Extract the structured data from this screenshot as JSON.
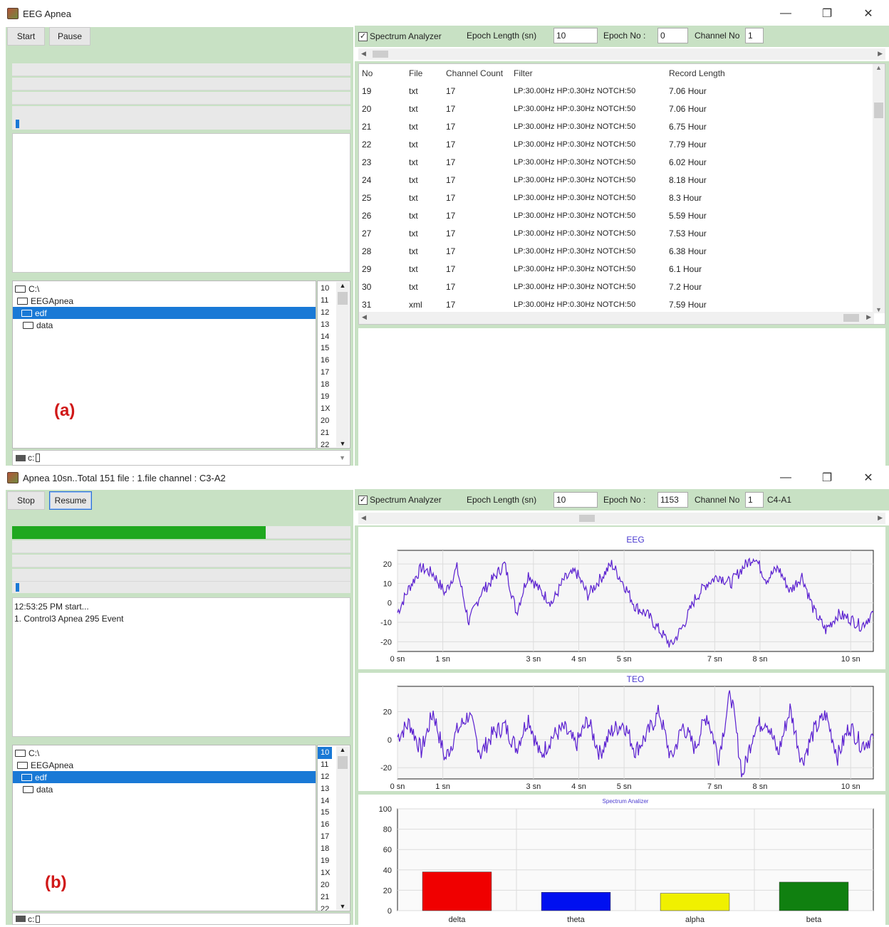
{
  "window_a": {
    "title": "EEG Apnea",
    "buttons": {
      "start": "Start",
      "pause": "Pause"
    },
    "toolbar": {
      "checkbox_checked": true,
      "checkbox_label": "Spectrum Analyzer",
      "epoch_length_label": "Epoch Length (sn)",
      "epoch_length_value": "10",
      "epoch_no_label": "Epoch No :",
      "epoch_no_value": "0",
      "channel_no_label": "Channel No",
      "channel_no_value": "1"
    },
    "table": {
      "headers": [
        "No",
        "File",
        "Channel Count",
        "Filter",
        "Record Length"
      ],
      "rows": [
        [
          "19",
          "txt",
          "17",
          "LP:30.00Hz HP:0.30Hz NOTCH:50",
          "7.06 Hour"
        ],
        [
          "20",
          "txt",
          "17",
          "LP:30.00Hz HP:0.30Hz NOTCH:50",
          "7.06 Hour"
        ],
        [
          "21",
          "txt",
          "17",
          "LP:30.00Hz HP:0.30Hz NOTCH:50",
          "6.75 Hour"
        ],
        [
          "22",
          "txt",
          "17",
          "LP:30.00Hz HP:0.30Hz NOTCH:50",
          "7.79 Hour"
        ],
        [
          "23",
          "txt",
          "17",
          "LP:30.00Hz HP:0.30Hz NOTCH:50",
          "6.02 Hour"
        ],
        [
          "24",
          "txt",
          "17",
          "LP:30.00Hz HP:0.30Hz NOTCH:50",
          "8.18 Hour"
        ],
        [
          "25",
          "txt",
          "17",
          "LP:30.00Hz HP:0.30Hz NOTCH:50",
          "8.3 Hour"
        ],
        [
          "26",
          "txt",
          "17",
          "LP:30.00Hz HP:0.30Hz NOTCH:50",
          "5.59 Hour"
        ],
        [
          "27",
          "txt",
          "17",
          "LP:30.00Hz HP:0.30Hz NOTCH:50",
          "7.53 Hour"
        ],
        [
          "28",
          "txt",
          "17",
          "LP:30.00Hz HP:0.30Hz NOTCH:50",
          "6.38 Hour"
        ],
        [
          "29",
          "txt",
          "17",
          "LP:30.00Hz HP:0.30Hz NOTCH:50",
          "6.1 Hour"
        ],
        [
          "30",
          "txt",
          "17",
          "LP:30.00Hz HP:0.30Hz NOTCH:50",
          "7.2 Hour"
        ],
        [
          "31",
          "xml",
          "17",
          "LP:30.00Hz HP:0.30Hz NOTCH:50",
          "7.59 Hour"
        ]
      ]
    },
    "tree": [
      "C:\\",
      "EEGApnea",
      "edf",
      "data"
    ],
    "files": [
      "10",
      "11",
      "12",
      "13",
      "14",
      "15",
      "16",
      "17",
      "18",
      "19",
      "1X",
      "20",
      "21",
      "22"
    ],
    "drive": "c:",
    "label": "(a)"
  },
  "window_b": {
    "title": "Apnea 10sn..Total 151  file : 1.file channel : C3-A2",
    "buttons": {
      "stop": "Stop",
      "resume": "Resume"
    },
    "progress_fraction": 0.75,
    "toolbar": {
      "checkbox_checked": true,
      "checkbox_label": "Spectrum Analyzer",
      "epoch_length_label": "Epoch Length (sn)",
      "epoch_length_value": "10",
      "epoch_no_label": "Epoch No :",
      "epoch_no_value": "1153",
      "channel_no_label": "Channel No",
      "channel_no_value": "1",
      "channel_name": "C4-A1"
    },
    "log": [
      "12:53:25 PM   start...",
      "1. Control3 Apnea 295 Event"
    ],
    "tree": [
      "C:\\",
      "EEGApnea",
      "edf",
      "data"
    ],
    "files": [
      "10",
      "11",
      "12",
      "13",
      "14",
      "15",
      "16",
      "17",
      "18",
      "19",
      "1X",
      "20",
      "21",
      "22"
    ],
    "drive": "c:",
    "label": "(b)"
  },
  "window_controls": {
    "minimize": "—",
    "restore": "❐",
    "close": "✕"
  },
  "colors": {
    "panel_green": "#c8e1c4",
    "selection_blue": "#1979d6",
    "signal_purple": "#5a1fd0",
    "progress_green": "#1fa81f"
  },
  "chart_data": [
    {
      "type": "line",
      "title": "EEG",
      "x_ticks": [
        "0 sn",
        "1 sn",
        "3 sn",
        "4 sn",
        "5 sn",
        "7 sn",
        "8 sn",
        "10 sn"
      ],
      "y_ticks": [
        20,
        10,
        0,
        -10,
        -20
      ],
      "ylim": [
        -25,
        27
      ],
      "xlim": [
        0,
        10.5
      ],
      "grid": true,
      "series": [
        {
          "values": [
            -5,
            8,
            18,
            15,
            5,
            18,
            -10,
            5,
            12,
            20,
            -5,
            15,
            6,
            0,
            12,
            16,
            4,
            12,
            20,
            10,
            -2,
            -6,
            -14,
            -22,
            -12,
            2,
            10,
            14,
            10,
            18,
            24,
            12,
            18,
            6,
            14,
            -4,
            -14,
            -6,
            -8,
            -12,
            -5
          ]
        }
      ]
    },
    {
      "type": "line",
      "title": "TEO",
      "x_ticks": [
        "0 sn",
        "1 sn",
        "3 sn",
        "4 sn",
        "5 sn",
        "7 sn",
        "8 sn",
        "10 sn"
      ],
      "y_ticks": [
        20,
        0,
        -20
      ],
      "ylim": [
        -28,
        38
      ],
      "xlim": [
        0,
        10.5
      ],
      "grid": true,
      "series": [
        {
          "values": [
            2,
            12,
            -8,
            20,
            -14,
            6,
            18,
            -10,
            4,
            10,
            -6,
            16,
            -12,
            2,
            8,
            -4,
            14,
            -10,
            6,
            12,
            -8,
            4,
            20,
            -14,
            10,
            -6,
            18,
            -12,
            34,
            -26,
            8,
            14,
            -10,
            22,
            -16,
            6,
            18,
            -12,
            10,
            -4,
            2
          ]
        }
      ]
    },
    {
      "type": "bar",
      "title": "Spectrum Analizer",
      "categories": [
        "delta",
        "theta",
        "alpha",
        "beta"
      ],
      "values": [
        38,
        18,
        17,
        28
      ],
      "colors": [
        "#f00000",
        "#0010f0",
        "#f0f000",
        "#108010"
      ],
      "ylim": [
        0,
        100
      ],
      "y_ticks": [
        100,
        80,
        60,
        40,
        20,
        0
      ],
      "grid": true
    }
  ]
}
